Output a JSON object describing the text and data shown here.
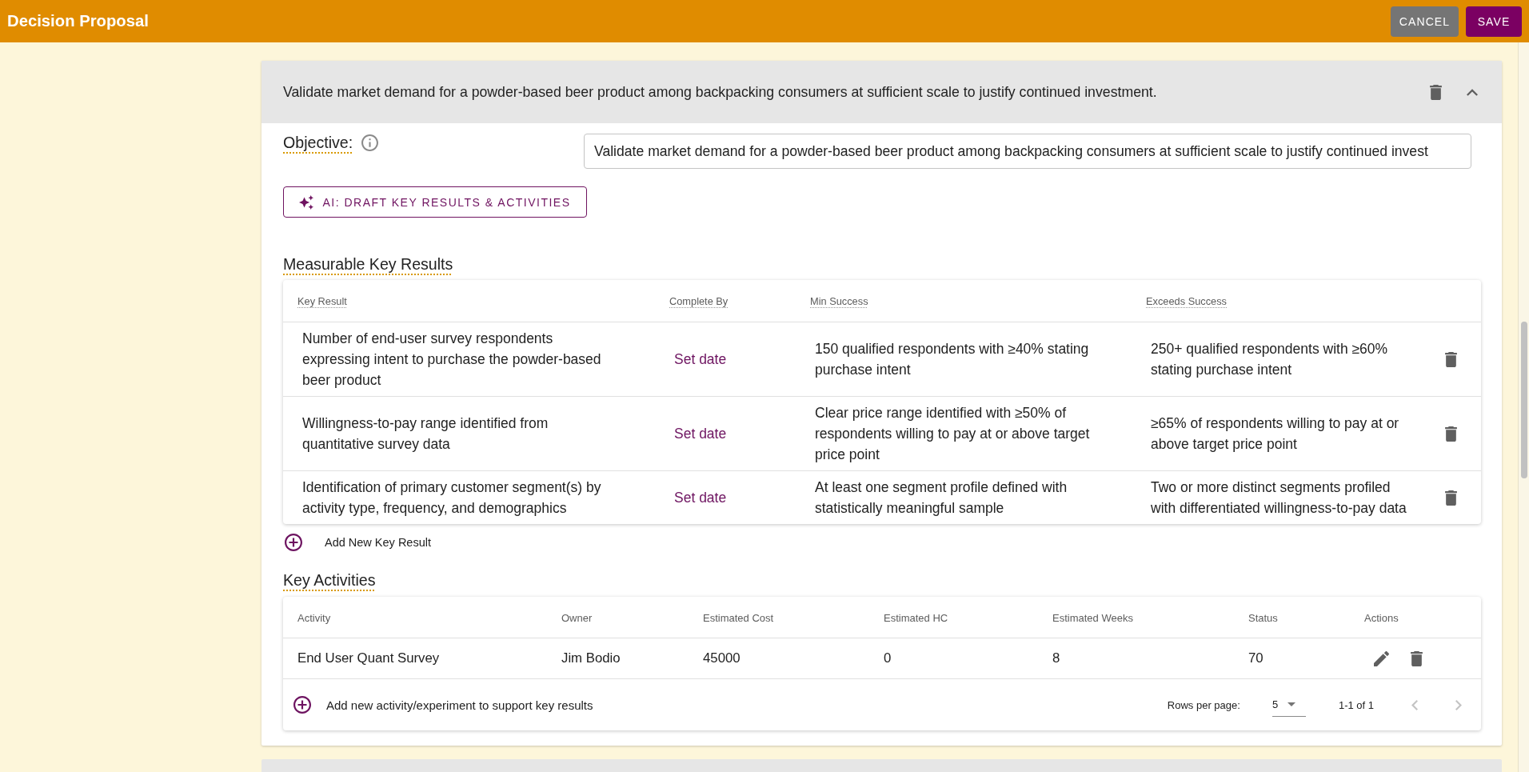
{
  "top_bar": {
    "title": "Decision Proposal",
    "buttons": [
      {
        "label": "CANCEL",
        "kind": "secondary"
      },
      {
        "label": "SAVE",
        "kind": "primary"
      }
    ]
  },
  "objective_panel": {
    "summary": "Validate market demand for a powder-based beer product among backpacking consumers at sufficient scale to justify continued investment.",
    "expanded": true,
    "objective_label": "Objective:",
    "objective_value": "Validate market demand for a powder-based beer product among backpacking consumers at sufficient scale to justify continued invest",
    "ai_button": "AI: DRAFT KEY RESULTS & ACTIVITIES",
    "key_results": {
      "title": "Measurable Key Results",
      "columns": [
        "Key Result",
        "Complete By",
        "Min Success",
        "Exceeds Success"
      ],
      "rows": [
        {
          "key_result": "Number of end-user survey respondents expressing intent to purchase the powder-based beer product",
          "complete_by": "Set date",
          "min_success": "150 qualified respondents with ≥40% stating purchase intent",
          "exceeds_success": "250+ qualified respondents with ≥60% stating purchase intent"
        },
        {
          "key_result": "Willingness-to-pay range identified from quantitative survey data",
          "complete_by": "Set date",
          "min_success": "Clear price range identified with ≥50% of respondents willing to pay at or above target price point",
          "exceeds_success": "≥65% of respondents willing to pay at or above target price point"
        },
        {
          "key_result": "Identification of primary customer segment(s) by activity type, frequency, and demographics",
          "complete_by": "Set date",
          "min_success": "At least one segment profile defined with statistically meaningful sample",
          "exceeds_success": "Two or more distinct segments profiled with differentiated willingness-to-pay data"
        }
      ],
      "add_label": "Add New Key Result"
    },
    "key_activities": {
      "title": "Key Activities",
      "columns": [
        "Activity",
        "Owner",
        "Estimated Cost",
        "Estimated HC",
        "Estimated Weeks",
        "Status",
        "Actions"
      ],
      "rows": [
        {
          "activity": "End User Quant Survey",
          "owner": "Jim Bodio",
          "estimated_cost": "45000",
          "estimated_hc": "0",
          "estimated_weeks": "8",
          "status": "70"
        }
      ],
      "add_label": "Add new activity/experiment to support key results",
      "pagination": {
        "rows_per_page_label": "Rows per page:",
        "rows_per_page": "5",
        "range": "1-1 of 1",
        "previous_disabled": true,
        "next_disabled": true
      }
    }
  }
}
